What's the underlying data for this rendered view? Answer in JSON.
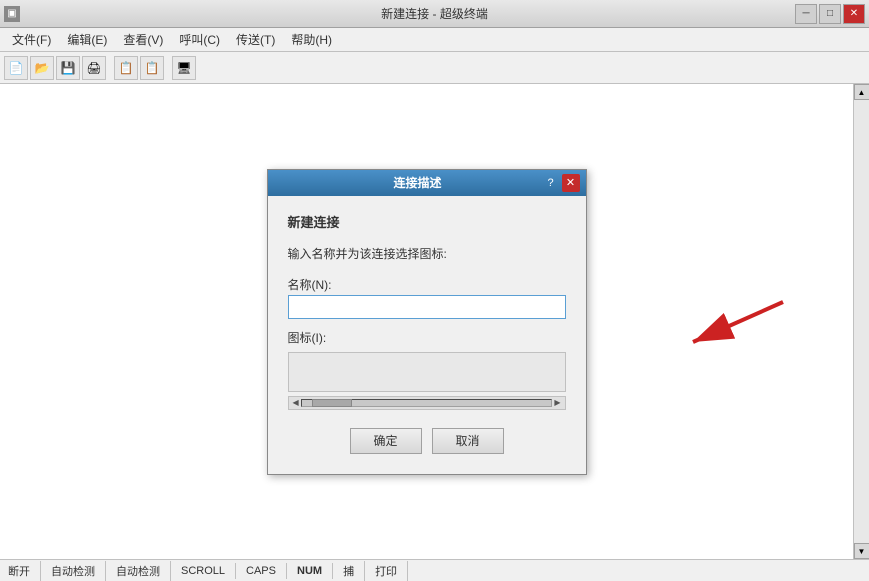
{
  "window": {
    "title": "新建连接 - 超级终端",
    "min_label": "─",
    "max_label": "□",
    "close_label": "✕"
  },
  "menubar": {
    "items": [
      {
        "label": "文件(F)"
      },
      {
        "label": "编辑(E)"
      },
      {
        "label": "查看(V)"
      },
      {
        "label": "呼叫(C)"
      },
      {
        "label": "传送(T)"
      },
      {
        "label": "帮助(H)"
      }
    ]
  },
  "toolbar": {
    "buttons": [
      "📄",
      "📂",
      "💾",
      "🖨",
      "📋",
      "📋",
      "🖥"
    ]
  },
  "dialog": {
    "title": "连接描述",
    "help_btn": "?",
    "close_btn": "✕",
    "section_title": "新建连接",
    "description": "输入名称并为该连接选择图标:",
    "name_label": "名称(N):",
    "icon_label": "图标(I):",
    "ok_btn": "确定",
    "cancel_btn": "取消"
  },
  "statusbar": {
    "items": [
      {
        "label": "断开",
        "active": false
      },
      {
        "label": "自动检测",
        "active": false
      },
      {
        "label": "自动检测",
        "active": false
      },
      {
        "label": "SCROLL",
        "active": false
      },
      {
        "label": "CAPS",
        "active": false
      },
      {
        "label": "NUM",
        "active": true
      },
      {
        "label": "捕",
        "active": false
      },
      {
        "label": "打印",
        "active": false
      }
    ]
  }
}
